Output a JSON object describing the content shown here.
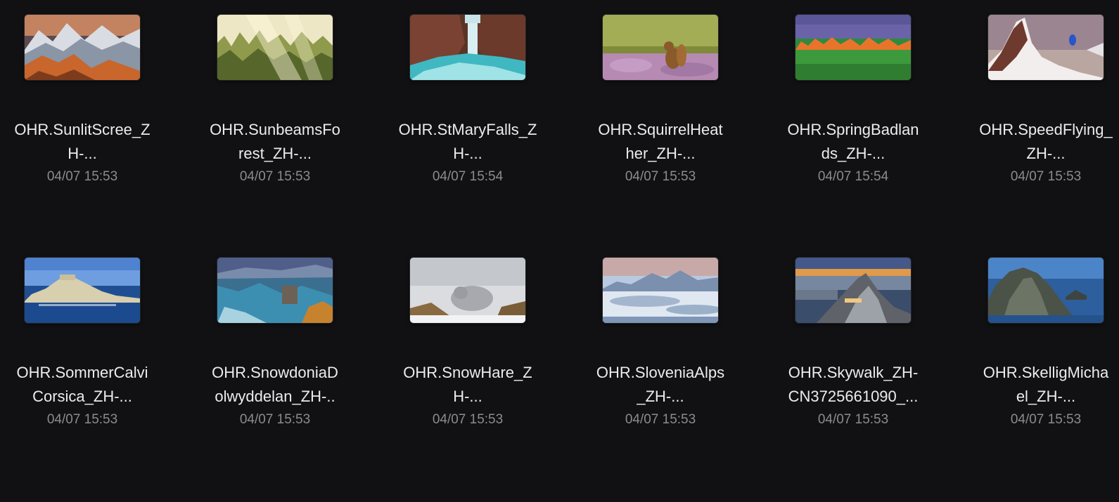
{
  "files": [
    {
      "name_line1": "OHR.SunlitScree_Z",
      "name_line2": "H-...",
      "date": "04/07 15:53",
      "thumbnail": "snowy-mountains-sunset"
    },
    {
      "name_line1": "OHR.SunbeamsFo",
      "name_line2": "rest_ZH-...",
      "date": "04/07 15:53",
      "thumbnail": "misty-forest-sunbeams"
    },
    {
      "name_line1": "OHR.StMaryFalls_Z",
      "name_line2": "H-...",
      "date": "04/07 15:54",
      "thumbnail": "waterfall-canyon"
    },
    {
      "name_line1": "OHR.SquirrelHeat",
      "name_line2": "her_ZH-...",
      "date": "04/07 15:53",
      "thumbnail": "squirrel-in-heather"
    },
    {
      "name_line1": "OHR.SpringBadlan",
      "name_line2": "ds_ZH-...",
      "date": "04/07 15:54",
      "thumbnail": "badlands-sunset"
    },
    {
      "name_line1": "OHR.SpeedFlying_",
      "name_line2": "ZH-...",
      "date": "04/07 15:53",
      "thumbnail": "speed-flying-peak"
    },
    {
      "name_line1": "OHR.SommerCalvi",
      "name_line2": "Corsica_ZH-...",
      "date": "04/07 15:53",
      "thumbnail": "coastal-citadel"
    },
    {
      "name_line1": "OHR.SnowdoniaD",
      "name_line2": "olwyddelan_ZH-..",
      "date": "04/07 15:53",
      "thumbnail": "castle-on-rocky-land"
    },
    {
      "name_line1": "OHR.SnowHare_Z",
      "name_line2": "H-...",
      "date": "04/07 15:53",
      "thumbnail": "snow-hare"
    },
    {
      "name_line1": "OHR.SloveniaAlps",
      "name_line2": "_ZH-...",
      "date": "04/07 15:53",
      "thumbnail": "alps-above-clouds"
    },
    {
      "name_line1": "OHR.Skywalk_ZH-",
      "name_line2": "CN3725661090_...",
      "date": "04/07 15:53",
      "thumbnail": "skywalk-cliff-city"
    },
    {
      "name_line1": "OHR.SkelligMicha",
      "name_line2": "el_ZH-...",
      "date": "04/07 15:53",
      "thumbnail": "sea-island-rock"
    }
  ],
  "colors": {
    "background": "#111114",
    "file_name": "#ececec",
    "file_date": "#8c8c8c"
  }
}
